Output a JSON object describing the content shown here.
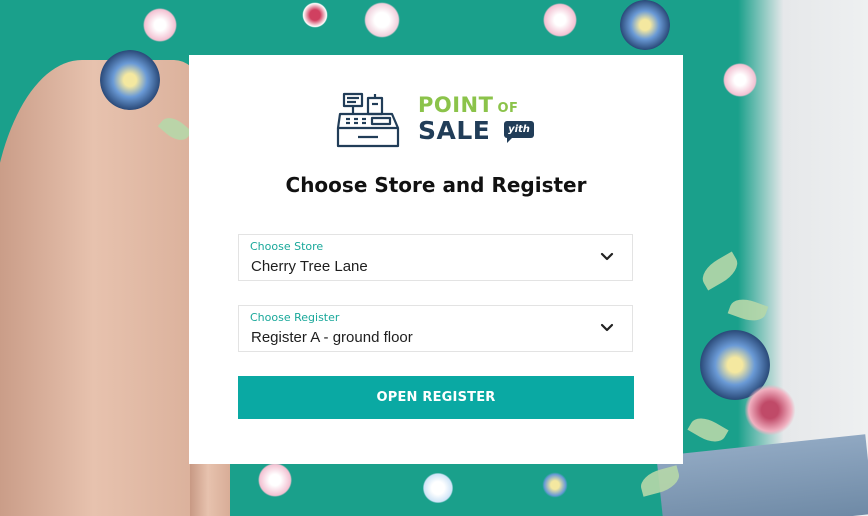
{
  "logo": {
    "brand_point": "POINT",
    "brand_of": "OF",
    "brand_sale": "SALE",
    "badge": "yith",
    "icon": "cash-register-icon",
    "colors": {
      "green": "#8bc34a",
      "navy": "#213d58"
    }
  },
  "title": "Choose Store and Register",
  "store_select": {
    "label": "Choose Store",
    "value": "Cherry Tree Lane",
    "icon": "chevron-down-icon"
  },
  "register_select": {
    "label": "Choose Register",
    "value": "Register A - ground floor",
    "icon": "chevron-down-icon"
  },
  "open_button": {
    "label": "OPEN REGISTER",
    "color": "#0aa9a3"
  },
  "colors": {
    "accent": "#0aa9a3",
    "field_label": "#19a89a",
    "background_teal": "#1aa08b"
  }
}
